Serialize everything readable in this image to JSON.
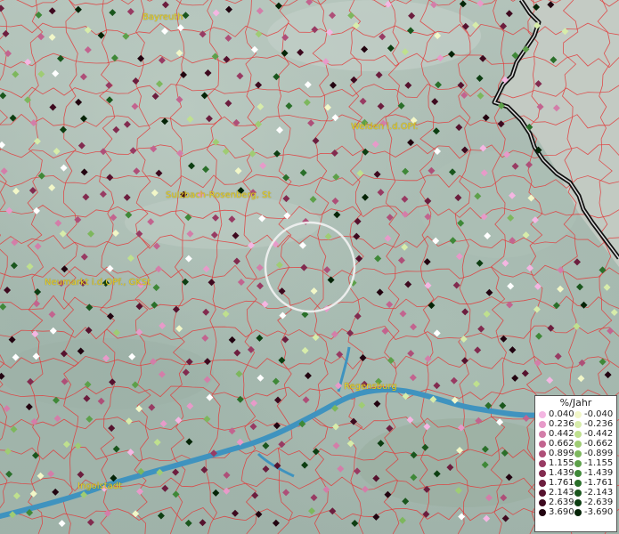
{
  "cities": [
    {
      "id": "bayreuth",
      "label": "Bayreuth"
    },
    {
      "id": "weiden",
      "label": "Weiden i.d.OPf."
    },
    {
      "id": "sulzbach",
      "label": "Sulzbach-Rosenberg, St"
    },
    {
      "id": "neumarkt",
      "label": "Neumarkt i.d.OPf., GKSt"
    },
    {
      "id": "regensburg",
      "label": "Regensburg"
    },
    {
      "id": "ingolstadt",
      "label": "Ingolstadt"
    }
  ],
  "legend": {
    "unit": "%/Jahr",
    "positive": [
      {
        "label": "0.040",
        "color": "#f4b6e2"
      },
      {
        "label": "0.236",
        "color": "#e79ac9"
      },
      {
        "label": "0.442",
        "color": "#d37ea9"
      },
      {
        "label": "0.662",
        "color": "#c2648f"
      },
      {
        "label": "0.899",
        "color": "#ae4f78"
      },
      {
        "label": "1.155",
        "color": "#983b63"
      },
      {
        "label": "1.439",
        "color": "#822b4f"
      },
      {
        "label": "1.761",
        "color": "#6c1e3e"
      },
      {
        "label": "2.143",
        "color": "#56122e"
      },
      {
        "label": "2.639",
        "color": "#3e0a1f"
      },
      {
        "label": "3.690",
        "color": "#220410"
      }
    ],
    "negative": [
      {
        "label": "-0.040",
        "color": "#f2f7c8"
      },
      {
        "label": "-0.236",
        "color": "#d7ecaa"
      },
      {
        "label": "-0.442",
        "color": "#bfe08e"
      },
      {
        "label": "-0.662",
        "color": "#9fcc74"
      },
      {
        "label": "-0.899",
        "color": "#7db75d"
      },
      {
        "label": "-1.155",
        "color": "#5da04a"
      },
      {
        "label": "-1.439",
        "color": "#3f8838"
      },
      {
        "label": "-1.761",
        "color": "#2a6f2a"
      },
      {
        "label": "-2.143",
        "color": "#1a561d"
      },
      {
        "label": "-2.639",
        "color": "#0d3e12"
      },
      {
        "label": "-3.690",
        "color": "#052407"
      }
    ]
  },
  "colors": {
    "boundary": "#e23a3a",
    "river": "#3f93bf",
    "border": "#111111",
    "label": "#e6cf2a"
  }
}
